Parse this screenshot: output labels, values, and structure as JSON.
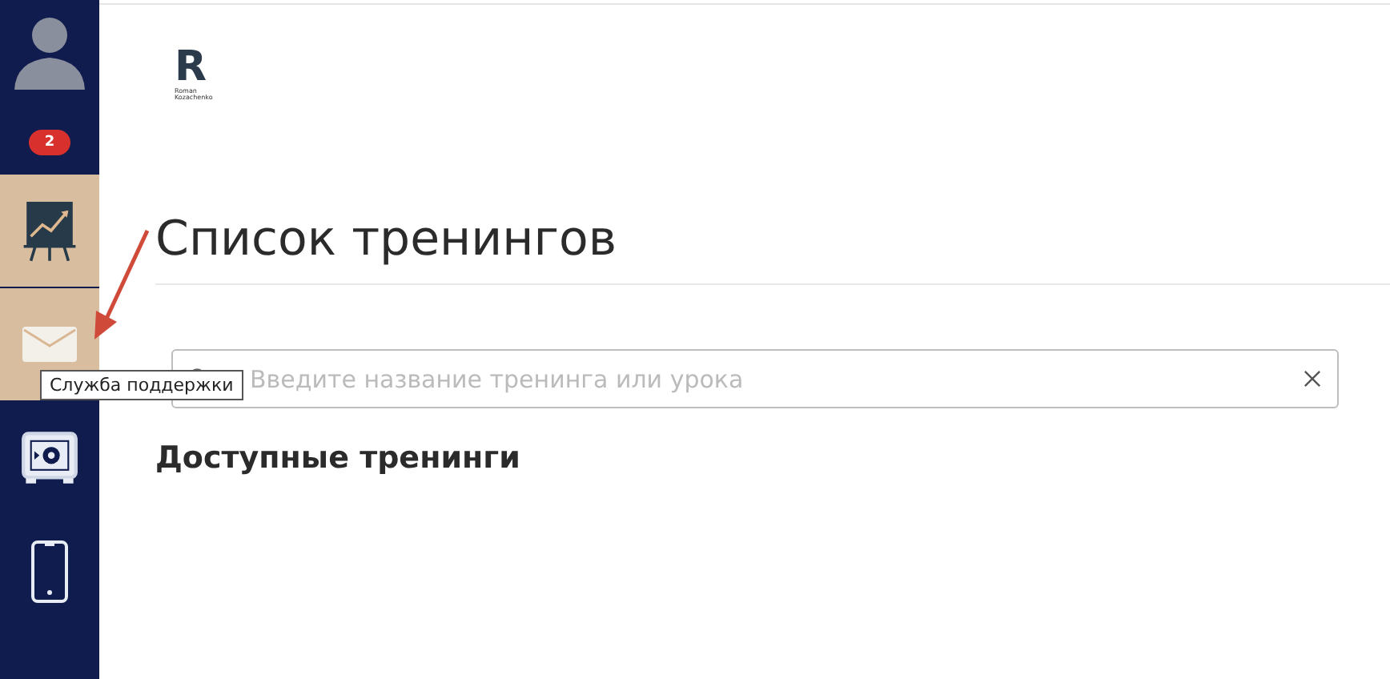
{
  "sidebar": {
    "badge": "2",
    "items": [
      {
        "kind": "chart",
        "selected": true
      },
      {
        "kind": "mail",
        "selected": true
      },
      {
        "kind": "safe",
        "selected": false
      },
      {
        "kind": "phone",
        "selected": false
      }
    ],
    "tooltip": "Служба поддержки"
  },
  "logo": {
    "letter": "R",
    "caption": [
      "Roman",
      "Kozachenko"
    ]
  },
  "title": "Список тренингов",
  "search": {
    "placeholder": "Введите название тренинга или урока"
  },
  "section_title": "Доступные тренинги"
}
